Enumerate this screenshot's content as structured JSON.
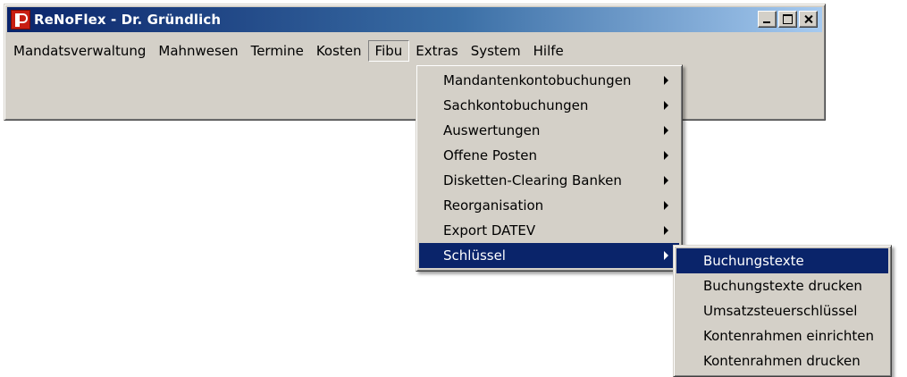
{
  "window": {
    "title": "ReNoFlex - Dr. Gründlich",
    "icon": "renoflex-logo-icon"
  },
  "menubar": {
    "items": [
      {
        "label": "Mandatsverwaltung"
      },
      {
        "label": "Mahnwesen"
      },
      {
        "label": "Termine"
      },
      {
        "label": "Kosten"
      },
      {
        "label": "Fibu",
        "active": true
      },
      {
        "label": "Extras"
      },
      {
        "label": "System"
      },
      {
        "label": "Hilfe"
      }
    ]
  },
  "fibu_menu": {
    "items": [
      {
        "label": "Mandantenkontobuchungen",
        "submenu": true
      },
      {
        "label": "Sachkontobuchungen",
        "submenu": true
      },
      {
        "label": "Auswertungen",
        "submenu": true
      },
      {
        "label": "Offene Posten",
        "submenu": true
      },
      {
        "label": "Disketten-Clearing Banken",
        "submenu": true
      },
      {
        "label": "Reorganisation",
        "submenu": true
      },
      {
        "label": "Export DATEV",
        "submenu": true
      },
      {
        "label": "Schlüssel",
        "submenu": true,
        "selected": true
      }
    ]
  },
  "schluessel_menu": {
    "items": [
      {
        "label": "Buchungstexte",
        "selected": true
      },
      {
        "label": "Buchungstexte drucken"
      },
      {
        "label": "Umsatzsteuerschlüssel"
      },
      {
        "label": "Kontenrahmen einrichten"
      },
      {
        "label": "Kontenrahmen drucken"
      }
    ]
  },
  "colors": {
    "highlight": "#0a246a",
    "face": "#d4d0c8",
    "title_gradient_start": "#0a246a",
    "title_gradient_end": "#a6caf0"
  }
}
